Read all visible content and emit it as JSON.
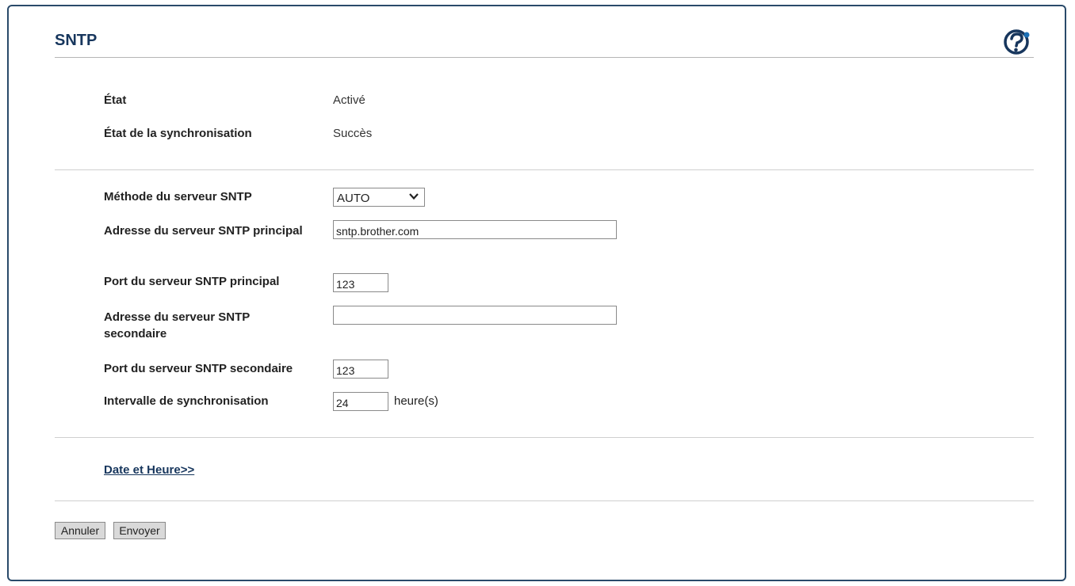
{
  "page": {
    "title": "SNTP",
    "help_icon": "help-icon"
  },
  "status": {
    "state_label": "État",
    "state_value": "Activé",
    "sync_label": "État de la synchronisation",
    "sync_value": "Succès"
  },
  "form": {
    "method_label": "Méthode du serveur SNTP",
    "method_value": "AUTO",
    "primary_addr_label": "Adresse du serveur SNTP principal",
    "primary_addr_value": "sntp.brother.com",
    "primary_port_label": "Port du serveur SNTP principal",
    "primary_port_value": "123",
    "secondary_addr_label": "Adresse du serveur SNTP secondaire",
    "secondary_addr_value": "",
    "secondary_port_label": "Port du serveur SNTP secondaire",
    "secondary_port_value": "123",
    "interval_label": "Intervalle de synchronisation",
    "interval_value": "24",
    "interval_unit": "heure(s)"
  },
  "links": {
    "date_time": "Date et Heure>>"
  },
  "buttons": {
    "cancel": "Annuler",
    "submit": "Envoyer"
  },
  "colors": {
    "title": "#17365d",
    "frame": "#2a4a6a",
    "help_icon": "#1b6fb5"
  }
}
